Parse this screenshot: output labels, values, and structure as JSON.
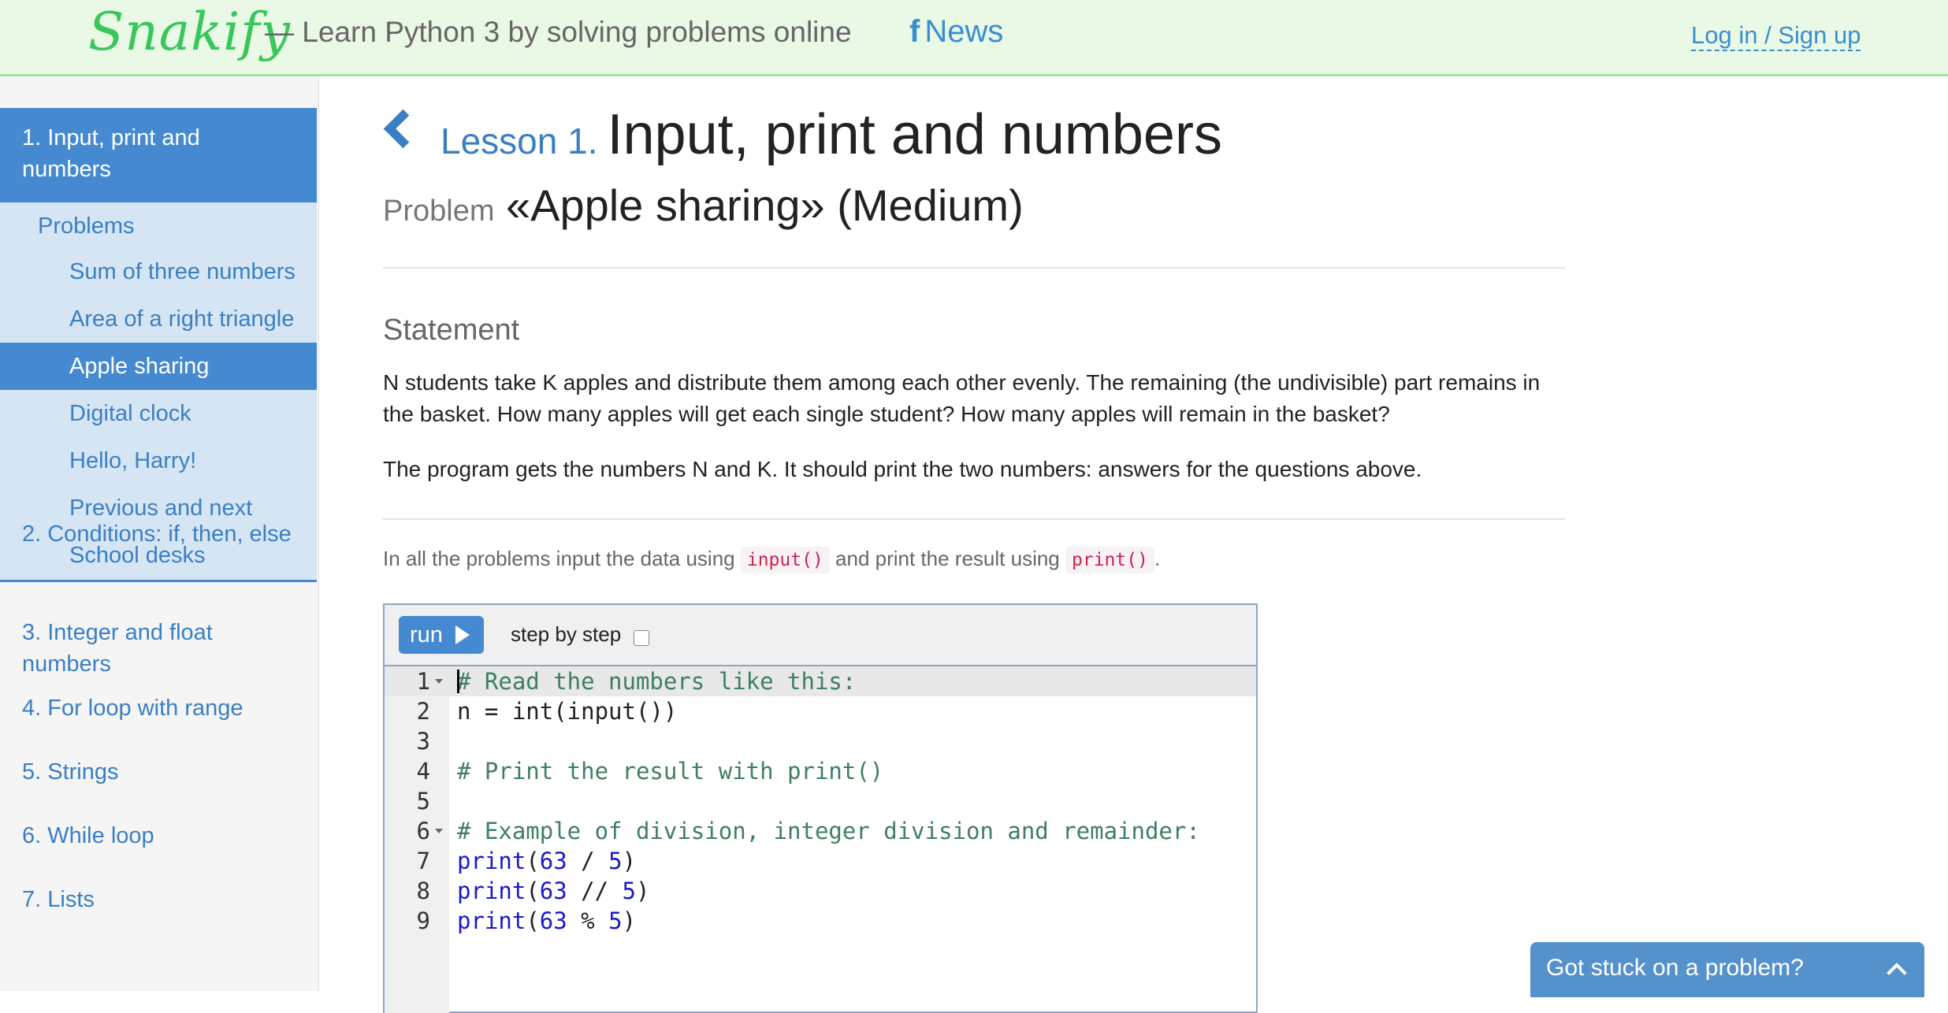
{
  "header": {
    "logo": "Snakify",
    "tagline": "— Learn Python 3 by solving problems online",
    "news_label": "News",
    "login_label": "Log in / Sign up"
  },
  "sidebar": {
    "active_lesson": "1. Input, print and numbers",
    "problems_label": "Problems",
    "problems": [
      {
        "label": "Sum of three numbers",
        "active": false
      },
      {
        "label": "Area of a right triangle",
        "active": false
      },
      {
        "label": "Apple sharing",
        "active": true
      },
      {
        "label": "Digital clock",
        "active": false
      },
      {
        "label": "Hello, Harry!",
        "active": false
      },
      {
        "label": "Previous and next",
        "active": false
      },
      {
        "label": "School desks",
        "active": false
      }
    ],
    "lessons": [
      "2. Conditions: if, then, else",
      "3. Integer and float numbers",
      "4. For loop with range",
      "5. Strings",
      "6. While loop",
      "7. Lists"
    ]
  },
  "main": {
    "lesson_label": "Lesson 1.",
    "lesson_name": "Input, print and numbers",
    "problem_label": "Problem",
    "problem_name": "«Apple sharing» (Medium)",
    "statement_title": "Statement",
    "statement_p1": "N students take K apples and distribute them among each other evenly. The remaining (the undivisible) part remains in the basket. How many apples will get each single student? How many apples will remain in the basket?",
    "statement_p2": "The program gets the numbers N and K. It should print the two numbers: answers for the questions above.",
    "hint_part1": "In all the problems input the data using",
    "hint_code1": "input()",
    "hint_part2": "and print the result using",
    "hint_code2": "print()",
    "hint_end": "."
  },
  "editor": {
    "run_label": "run",
    "step_label": "step by step",
    "step_checked": false,
    "lines": [
      {
        "n": "1",
        "fold": true,
        "active": true,
        "tokens": [
          {
            "t": "# Read the numbers like this:",
            "c": "com"
          }
        ]
      },
      {
        "n": "2",
        "fold": false,
        "active": false,
        "tokens": [
          {
            "t": "n = int(input())",
            "c": "txt"
          }
        ]
      },
      {
        "n": "3",
        "fold": false,
        "active": false,
        "tokens": []
      },
      {
        "n": "4",
        "fold": false,
        "active": false,
        "tokens": [
          {
            "t": "# Print the result with print()",
            "c": "com"
          }
        ]
      },
      {
        "n": "5",
        "fold": false,
        "active": false,
        "tokens": []
      },
      {
        "n": "6",
        "fold": true,
        "active": false,
        "tokens": [
          {
            "t": "# Example of division, integer division and remainder:",
            "c": "com"
          }
        ]
      },
      {
        "n": "7",
        "fold": false,
        "active": false,
        "tokens": [
          {
            "t": "print",
            "c": "kw"
          },
          {
            "t": "(",
            "c": "txt"
          },
          {
            "t": "63",
            "c": "num"
          },
          {
            "t": " / ",
            "c": "txt"
          },
          {
            "t": "5",
            "c": "num"
          },
          {
            "t": ")",
            "c": "txt"
          }
        ]
      },
      {
        "n": "8",
        "fold": false,
        "active": false,
        "tokens": [
          {
            "t": "print",
            "c": "kw"
          },
          {
            "t": "(",
            "c": "txt"
          },
          {
            "t": "63",
            "c": "num"
          },
          {
            "t": " // ",
            "c": "txt"
          },
          {
            "t": "5",
            "c": "num"
          },
          {
            "t": ")",
            "c": "txt"
          }
        ]
      },
      {
        "n": "9",
        "fold": false,
        "active": false,
        "tokens": [
          {
            "t": "print",
            "c": "kw"
          },
          {
            "t": "(",
            "c": "txt"
          },
          {
            "t": "63",
            "c": "num"
          },
          {
            "t": " % ",
            "c": "txt"
          },
          {
            "t": "5",
            "c": "num"
          },
          {
            "t": ")",
            "c": "txt"
          }
        ]
      }
    ]
  },
  "help_widget": {
    "label": "Got stuck on a problem?"
  },
  "colors": {
    "accent": "#458ad0",
    "header_bg": "#eaf8e6",
    "logo": "#38c75a",
    "code_comment": "#3f7f5f",
    "code_keyword": "#1a1ac8",
    "inline_code": "#c7254e"
  }
}
